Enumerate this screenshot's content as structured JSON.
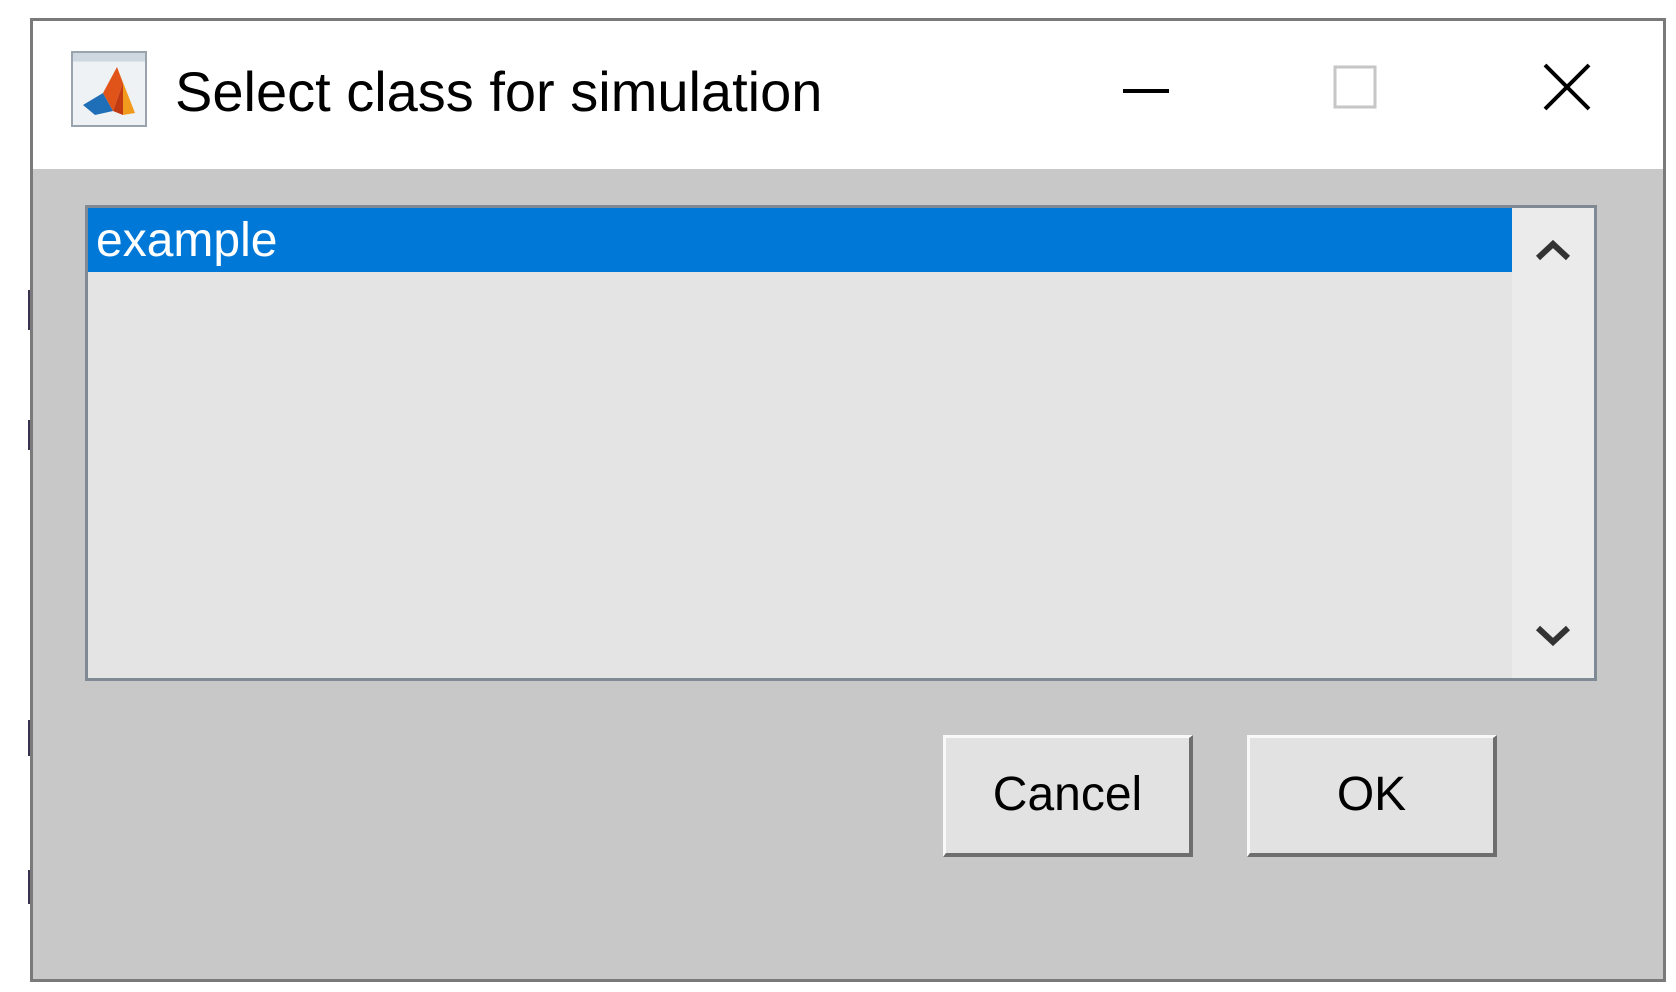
{
  "window": {
    "title": "Select class for simulation",
    "icon": "matlab-logo-icon",
    "controls": {
      "minimize": "minimize-icon",
      "maximize": "maximize-icon",
      "close": "close-icon"
    }
  },
  "list": {
    "items": [
      {
        "label": "example",
        "selected": true
      }
    ],
    "selected_color": "#0078d7"
  },
  "buttons": {
    "cancel_label": "Cancel",
    "ok_label": "OK"
  },
  "colors": {
    "dialog_background": "#c8c8c8",
    "list_background": "#e4e4e4",
    "titlebar_background": "#ffffff"
  }
}
